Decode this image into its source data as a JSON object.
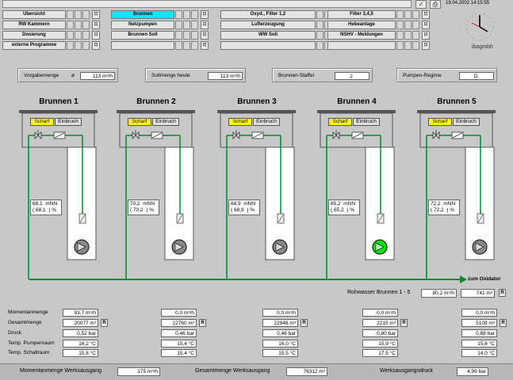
{
  "header": {
    "datetime": "19.04.2002 14:15:55",
    "company": "ibagmbh"
  },
  "nav": {
    "col1": [
      "Übersicht",
      "RW Kammern",
      "Dosierung",
      "externe Programme"
    ],
    "col2": [
      "Brunnen",
      "Netzpumpen",
      "Brunnen Soll",
      ""
    ],
    "col3": [
      "Oxyd., Filter 1,2",
      "Lufterzeugung",
      "WW Soll",
      ""
    ],
    "col4": [
      "Filter 3,4,5",
      "Hebeanlage",
      "NSHV - Meldungen",
      ""
    ],
    "active": "Brunnen"
  },
  "info": {
    "vorgabe_label": "Vorgabemenge",
    "vorgabe_symbol": "ø",
    "vorgabe_value": "113  m³/h",
    "soll_label": "Sollmenge heute",
    "soll_value": "113  m³/h",
    "staffel_label": "Brunnen-Staffel",
    "staffel_value": "2",
    "regime_label": "Pumpen-Regime",
    "regime_value": "D"
  },
  "wells": [
    {
      "name": "Brunnen 1",
      "scharf": "Scharf",
      "einbruch": "Einbruch",
      "level": "68,1  mNN",
      "pct": "( 68,1  ) %",
      "active": false
    },
    {
      "name": "Brunnen 2",
      "scharf": "Scharf",
      "einbruch": "Einbruch",
      "level": "70,2  mNN",
      "pct": "( 70,2  ) %",
      "active": false
    },
    {
      "name": "Brunnen 3",
      "scharf": "Scharf",
      "einbruch": "Einbruch",
      "level": "68,9  mNN",
      "pct": "( 68,9  ) %",
      "active": false
    },
    {
      "name": "Brunnen 4",
      "scharf": "Scharf",
      "einbruch": "Einbruch",
      "level": "65,2  mNN",
      "pct": "( 65,2  ) %",
      "active": true
    },
    {
      "name": "Brunnen 5",
      "scharf": "Scharf",
      "einbruch": "Einbruch",
      "level": "72,2  mNN",
      "pct": "( 72,2  ) %",
      "active": false
    }
  ],
  "pipe": {
    "oxidator_label": "zum Oxidator",
    "rohwasser_label": "Rohwasser Brunnen 1 - 5",
    "rohwasser_flow": "80,2  m³/h",
    "rohwasser_total": "741 m³",
    "r_label": "R"
  },
  "rows": {
    "labels": [
      "Momentanmenge",
      "Gesamtmenge",
      "Druck",
      "Temp. Pumpenraum",
      "Temp. Schaltraum"
    ],
    "wells": [
      [
        "93,7  m³/h",
        "20077  m³",
        "0,52  bar",
        "16,2  °C",
        "15,8  °C"
      ],
      [
        "0,0  m³/h",
        "22760  m³",
        "0,46  bar",
        "15,4  °C",
        "15,4  °C"
      ],
      [
        "0,0  m³/h",
        "22948  m³",
        "0,46  bar",
        "16,0  °C",
        "15,5  °C"
      ],
      [
        "0,0  m³/h",
        "2215  m³",
        "0,80  bar",
        "15,9  °C",
        "17,5  °C"
      ],
      [
        "0,0  m³/h",
        "5109  m³",
        "0,88  bar",
        "15,6  °C",
        "14,0  °C"
      ]
    ]
  },
  "footer": {
    "moment_label": "Momentanmenge Werksausgang",
    "moment_value": "175  m³/h",
    "gesamt_label": "Gesamtmenge Werksausgang",
    "gesamt_value": "76312  m³",
    "druck_label": "Werksausgangsdruck",
    "druck_value": "4,99  bar"
  },
  "colors": {
    "active_nav": "#00e8f0",
    "water": "#008a2e",
    "pipe": "#008a2e",
    "pump_active": "#00e000",
    "scharf": "#ffff00"
  }
}
